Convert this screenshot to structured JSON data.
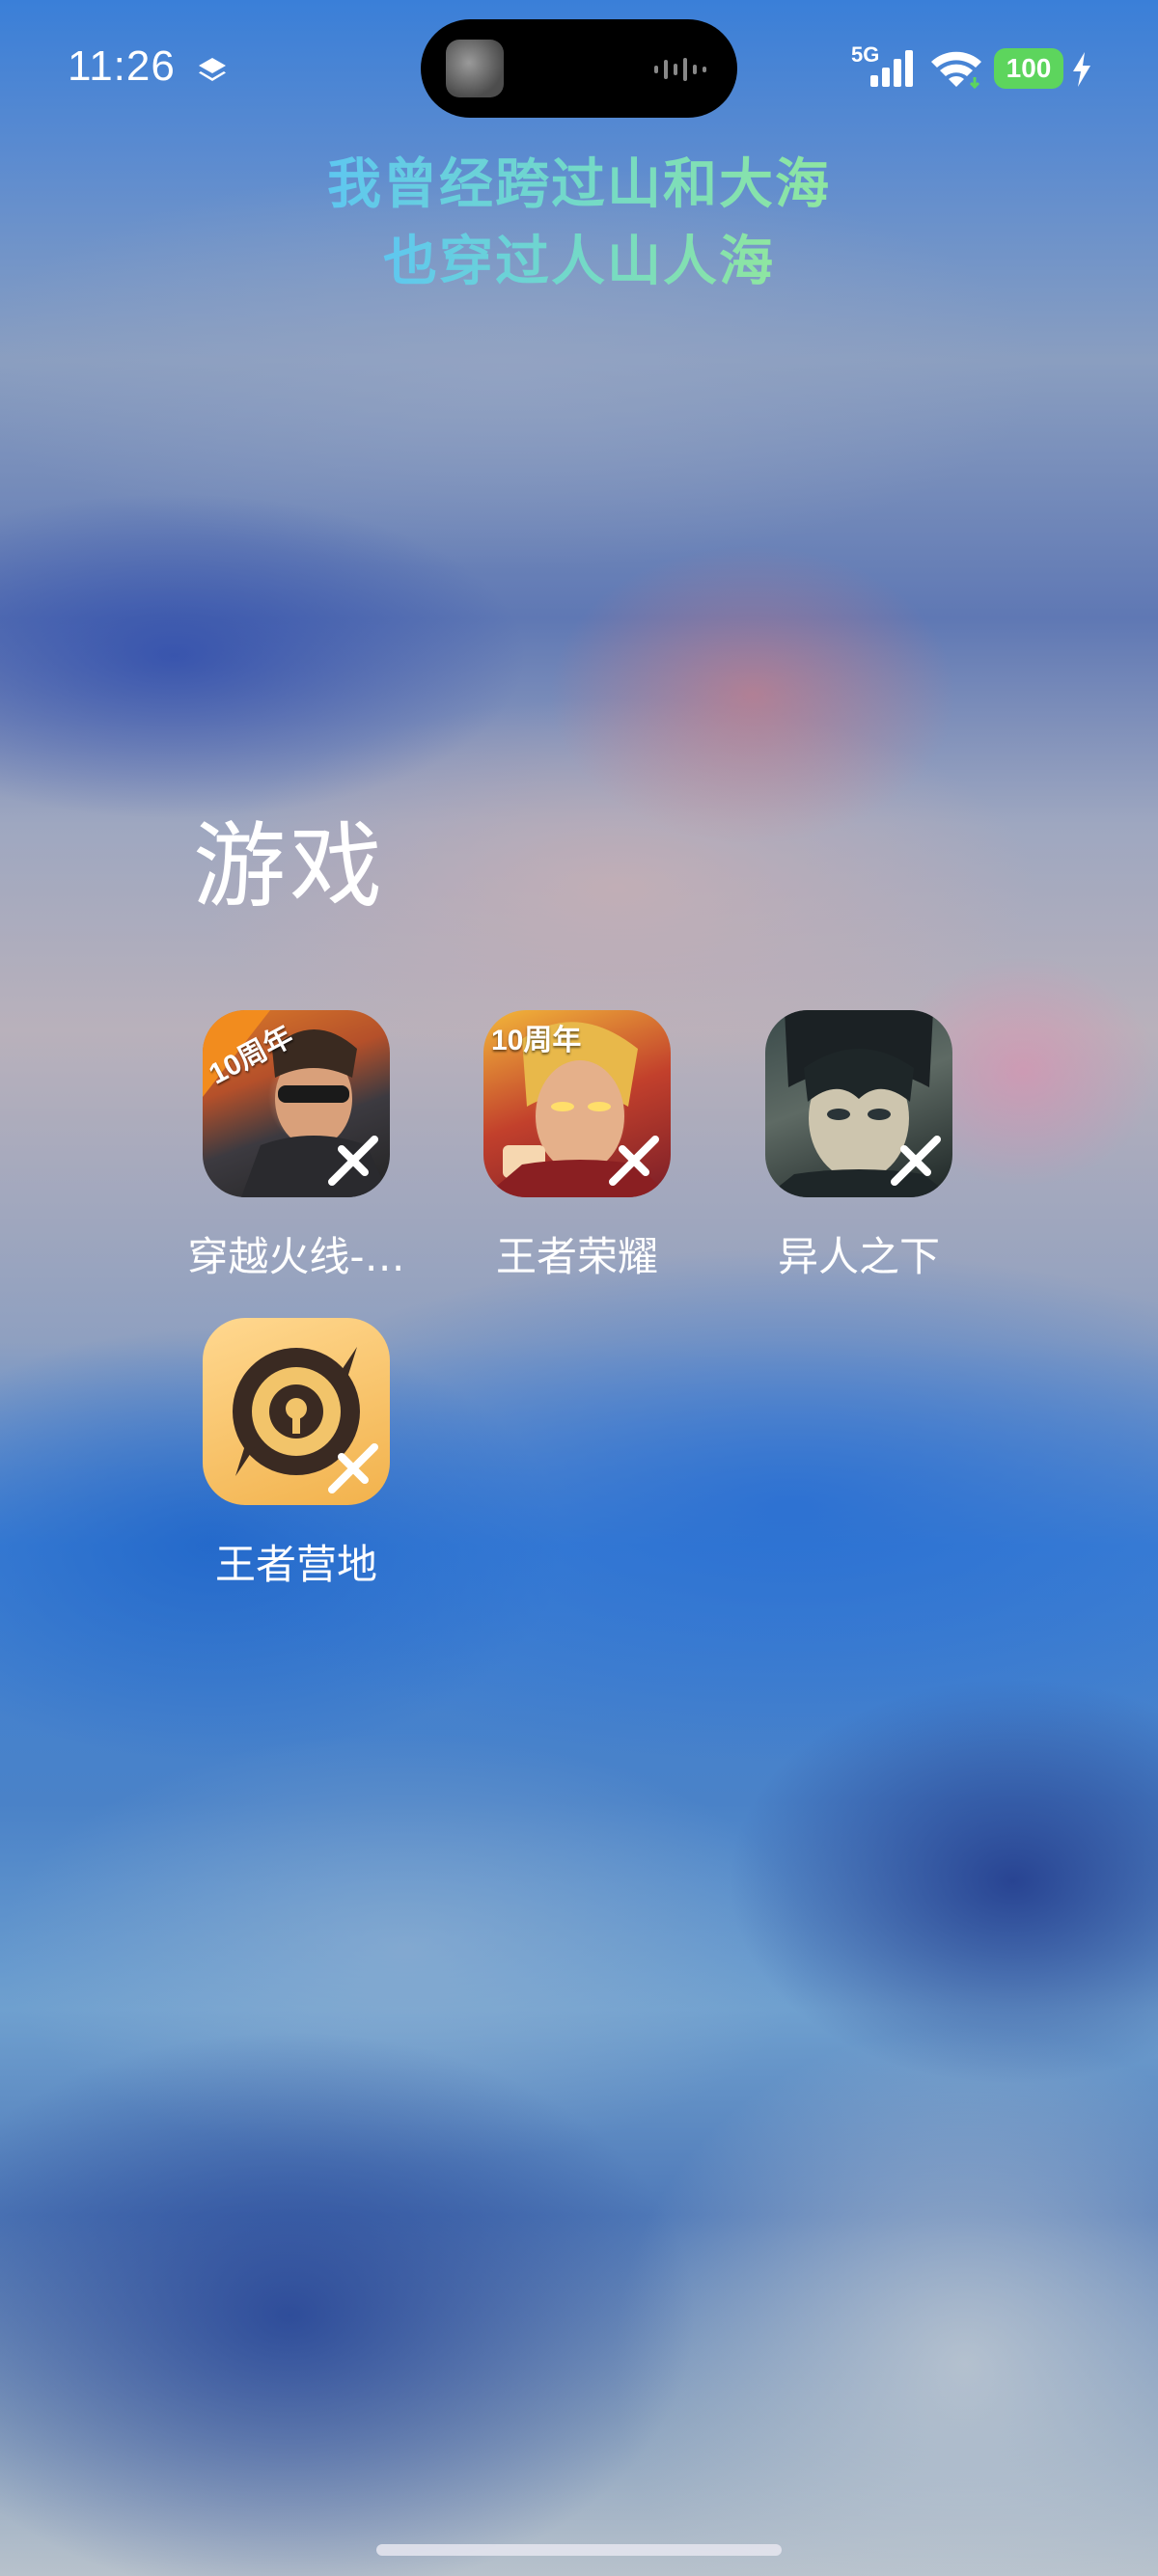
{
  "status_bar": {
    "time": "11:26",
    "network": "5G",
    "battery": "100",
    "icons": [
      "layers-icon",
      "cellular-signal-icon",
      "wifi-icon",
      "battery-icon",
      "charging-bolt-icon"
    ]
  },
  "lyrics": {
    "line1": "我曾经跨过山和大海",
    "line2": "也穿过人山人海"
  },
  "folder": {
    "title": "游戏",
    "apps": [
      {
        "label": "穿越火线-…",
        "badge": "10周年",
        "icon": "crossfire-app-icon"
      },
      {
        "label": "王者荣耀",
        "badge": "10周年",
        "icon": "honor-of-kings-app-icon"
      },
      {
        "label": "异人之下",
        "icon": "yiren-zhixia-app-icon"
      },
      {
        "label": "王者营地",
        "icon": "wangzhe-yingdi-app-icon"
      }
    ]
  },
  "colors": {
    "battery_green": "#5dd55d",
    "lyric_gradient_start": "#5ec7f0",
    "lyric_gradient_end": "#8fe6a0"
  }
}
